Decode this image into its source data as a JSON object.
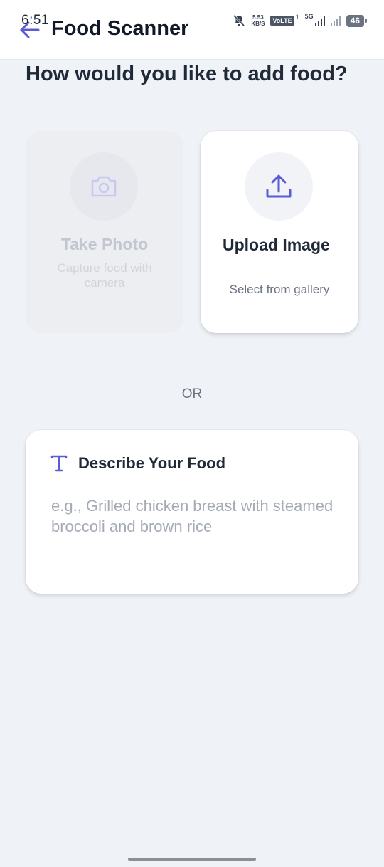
{
  "status_bar": {
    "time": "6:51",
    "net_speed_value": "5.53",
    "net_speed_unit": "KB/S",
    "volte": "VoLTE",
    "sim_label": "1",
    "network_label": "5G",
    "battery": "46"
  },
  "header": {
    "title": "Food Scanner",
    "back_icon": "arrow-left-icon"
  },
  "question": "How would you like to add food?",
  "options": [
    {
      "title": "Take Photo",
      "subtitle": "Capture food with camera",
      "icon": "camera-icon",
      "disabled": true
    },
    {
      "title": "Upload Image",
      "subtitle": "Select from gallery",
      "icon": "upload-icon",
      "disabled": false
    }
  ],
  "divider_text": "OR",
  "describe": {
    "title": "Describe Your Food",
    "icon": "text-icon",
    "placeholder": "e.g., Grilled chicken breast with steamed broccoli and brown rice",
    "value": ""
  },
  "colors": {
    "accent": "#5b5bd6",
    "background": "#eff2f7",
    "card": "#ffffff"
  }
}
